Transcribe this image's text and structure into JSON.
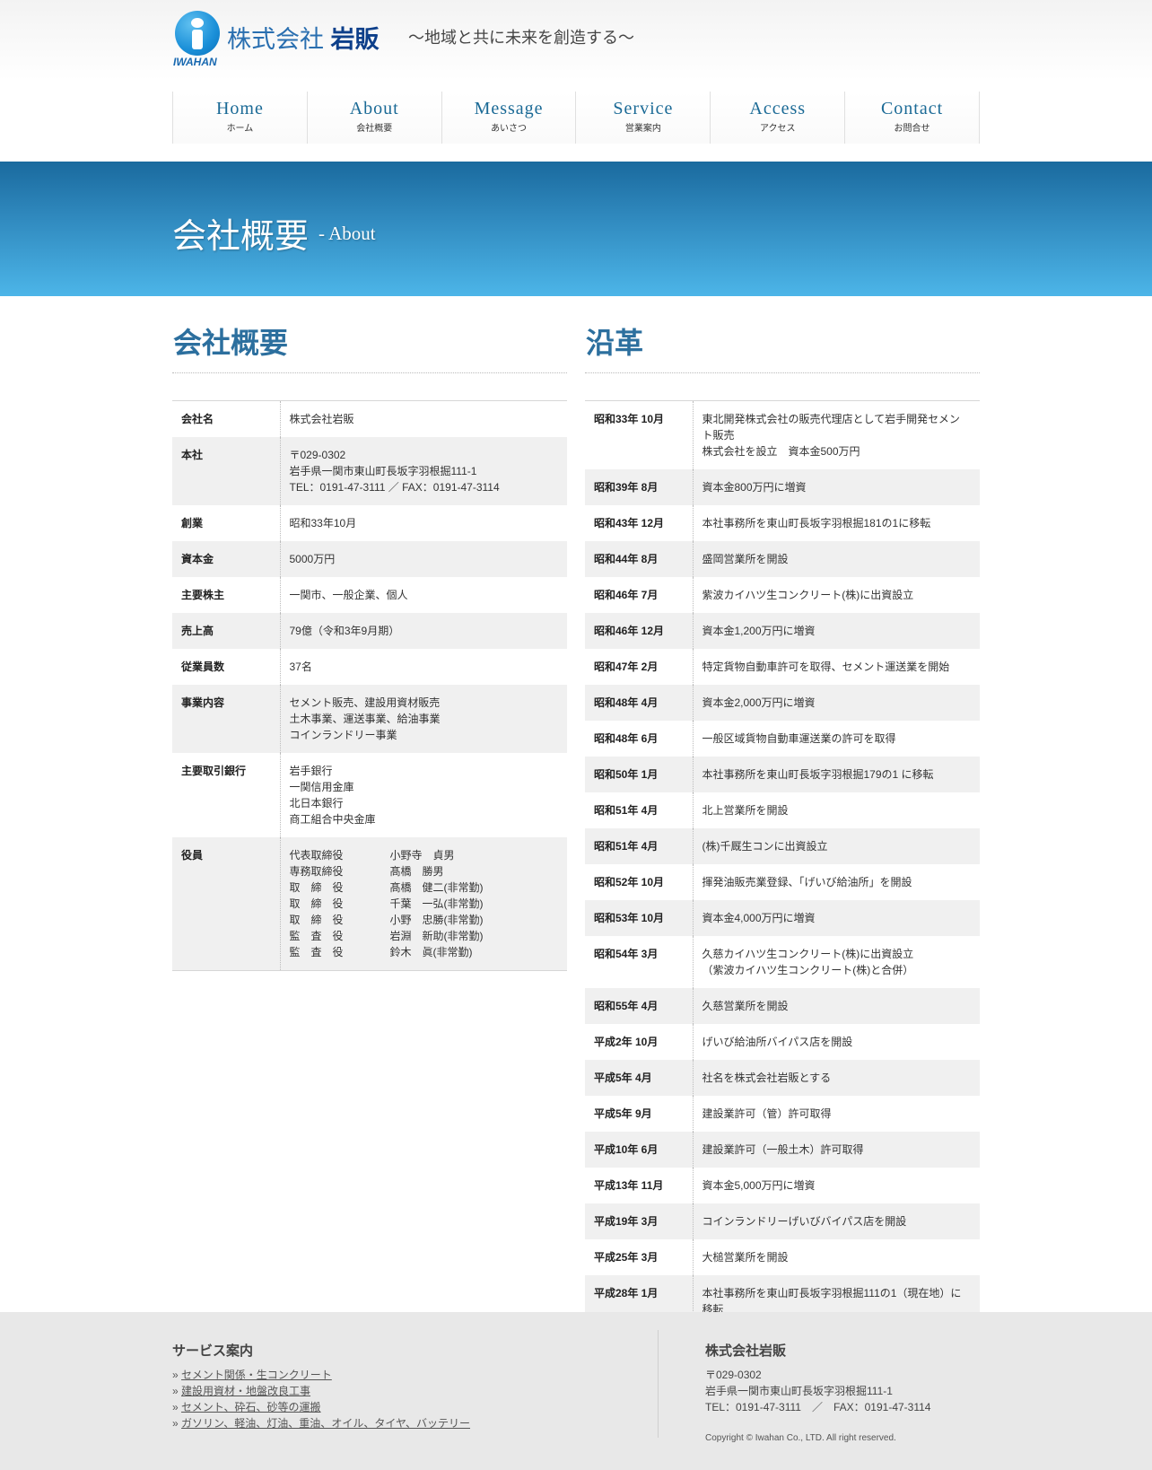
{
  "header": {
    "logo_sub": "IWAHAN",
    "logo_prefix": "株式会社",
    "logo_name": "岩販",
    "tagline": "〜地域と共に未来を創造する〜"
  },
  "nav": [
    {
      "en": "Home",
      "ja": "ホーム"
    },
    {
      "en": "About",
      "ja": "会社概要"
    },
    {
      "en": "Message",
      "ja": "あいさつ"
    },
    {
      "en": "Service",
      "ja": "営業案内"
    },
    {
      "en": "Access",
      "ja": "アクセス"
    },
    {
      "en": "Contact",
      "ja": "お問合せ"
    }
  ],
  "banner": {
    "title": "会社概要",
    "sub": "- About"
  },
  "overview": {
    "title": "会社概要",
    "rows": [
      {
        "label": "会社名",
        "lines": [
          "株式会社岩販"
        ]
      },
      {
        "label": "本社",
        "lines": [
          "〒029-0302",
          "岩手県一関市東山町長坂字羽根掘111-1",
          "TEL：0191-47-3111 ／ FAX：0191-47-3114"
        ]
      },
      {
        "label": "創業",
        "lines": [
          "昭和33年10月"
        ]
      },
      {
        "label": "資本金",
        "lines": [
          "5000万円"
        ]
      },
      {
        "label": "主要株主",
        "lines": [
          "一関市、一般企業、個人"
        ]
      },
      {
        "label": "売上高",
        "lines": [
          "79億（令和3年9月期）"
        ]
      },
      {
        "label": "従業員数",
        "lines": [
          "37名"
        ]
      },
      {
        "label": "事業内容",
        "lines": [
          "セメント販売、建設用資材販売",
          "土木事業、運送事業、給油事業",
          "コインランドリー事業"
        ]
      },
      {
        "label": "主要取引銀行",
        "lines": [
          "岩手銀行",
          "一関信用金庫",
          "北日本銀行",
          "商工組合中央金庫"
        ]
      }
    ],
    "officers_label": "役員",
    "officers": [
      {
        "role": "代表取締役",
        "name": "小野寺　貞男"
      },
      {
        "role": "専務取締役",
        "name": "髙橋　勝男"
      },
      {
        "role": "取　締　役",
        "name": "髙橋　健二(非常勤)"
      },
      {
        "role": "取　締　役",
        "name": "千葉　一弘(非常勤)"
      },
      {
        "role": "取　締　役",
        "name": "小野　忠勝(非常勤)"
      },
      {
        "role": "監　査　役",
        "name": "岩淵　新助(非常勤)"
      },
      {
        "role": "監　査　役",
        "name": "鈴木　眞(非常勤)"
      }
    ]
  },
  "history": {
    "title": "沿革",
    "rows": [
      {
        "date": "昭和33年 10月",
        "lines": [
          "東北開発株式会社の販売代理店として岩手開発セメン",
          "ト販売",
          "株式会社を設立　資本金500万円"
        ]
      },
      {
        "date": "昭和39年 8月",
        "lines": [
          "資本金800万円に増資"
        ]
      },
      {
        "date": "昭和43年 12月",
        "lines": [
          "本社事務所を東山町長坂字羽根掘181の1に移転"
        ]
      },
      {
        "date": "昭和44年 8月",
        "lines": [
          "盛岡営業所を開設"
        ]
      },
      {
        "date": "昭和46年 7月",
        "lines": [
          "紫波カイハツ生コンクリート(株)に出資設立"
        ]
      },
      {
        "date": "昭和46年 12月",
        "lines": [
          "資本金1,200万円に増資"
        ]
      },
      {
        "date": "昭和47年 2月",
        "lines": [
          "特定貨物自動車許可を取得、セメント運送業を開始"
        ]
      },
      {
        "date": "昭和48年 4月",
        "lines": [
          "資本金2,000万円に増資"
        ]
      },
      {
        "date": "昭和48年 6月",
        "lines": [
          "一般区域貨物自動車運送業の許可を取得"
        ]
      },
      {
        "date": "昭和50年 1月",
        "lines": [
          "本社事務所を東山町長坂字羽根掘179の1 に移転"
        ]
      },
      {
        "date": "昭和51年 4月",
        "lines": [
          "北上営業所を開設"
        ]
      },
      {
        "date": "昭和51年 4月",
        "lines": [
          "(株)千厩生コンに出資設立"
        ]
      },
      {
        "date": "昭和52年 10月",
        "lines": [
          "揮発油販売業登録、「げいび給油所」を開設"
        ]
      },
      {
        "date": "昭和53年 10月",
        "lines": [
          "資本金4,000万円に増資"
        ]
      },
      {
        "date": "昭和54年 3月",
        "lines": [
          "久慈カイハツ生コンクリート(株)に出資設立",
          "（紫波カイハツ生コンクリート(株)と合併）"
        ]
      },
      {
        "date": "昭和55年 4月",
        "lines": [
          "久慈営業所を開設"
        ]
      },
      {
        "date": "平成2年 10月",
        "lines": [
          "げいび給油所バイパス店を開設"
        ]
      },
      {
        "date": "平成5年 4月",
        "lines": [
          "社名を株式会社岩販とする"
        ]
      },
      {
        "date": "平成5年 9月",
        "lines": [
          "建設業許可（管）許可取得"
        ]
      },
      {
        "date": "平成10年 6月",
        "lines": [
          "建設業許可（一般土木）許可取得"
        ]
      },
      {
        "date": "平成13年 11月",
        "lines": [
          "資本金5,000万円に増資"
        ]
      },
      {
        "date": "平成19年 3月",
        "lines": [
          "コインランドリーげいびバイパス店を開設"
        ]
      },
      {
        "date": "平成25年 3月",
        "lines": [
          "大槌営業所を開設"
        ]
      },
      {
        "date": "平成28年 1月",
        "lines": [
          "本社事務所を東山町長坂字羽根掘111の1（現在地）に",
          "移転"
        ]
      }
    ]
  },
  "footer": {
    "services_title": "サービス案内",
    "bullet": "»",
    "services": [
      "セメント関係・生コンクリート",
      "建設用資材・地盤改良工事",
      "セメント、砕石、砂等の運搬",
      "ガソリン、軽油、灯油、重油、オイル、タイヤ、バッテリー"
    ],
    "company_title": "株式会社岩販",
    "postal": "〒029-0302",
    "address": "岩手県一関市東山町長坂字羽根掘111-1",
    "tel_fax": "TEL：0191-47-3111　／　FAX：0191-47-3114",
    "copyright": "Copyright © Iwahan Co., LTD. All right reserved."
  }
}
